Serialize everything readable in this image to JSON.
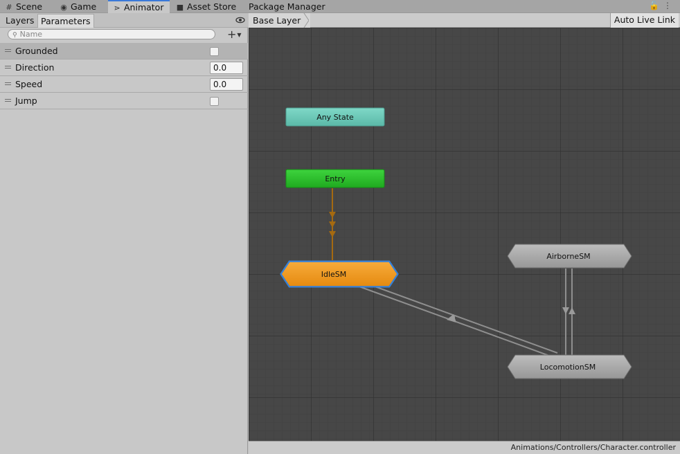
{
  "tabs": [
    {
      "label": "Scene",
      "icon": "grid-icon"
    },
    {
      "label": "Game",
      "icon": "gamepad-icon"
    },
    {
      "label": "Animator",
      "icon": "animator-icon",
      "active": true
    },
    {
      "label": "Asset Store",
      "icon": "bag-icon"
    },
    {
      "label": "Package Manager",
      "icon": "package-icon"
    }
  ],
  "left_panel": {
    "tabs": [
      "Layers",
      "Parameters"
    ],
    "search_placeholder": "Name",
    "parameters": [
      {
        "name": "Grounded",
        "type": "bool",
        "value": false,
        "selected": true
      },
      {
        "name": "Direction",
        "type": "float",
        "value": "0.0"
      },
      {
        "name": "Speed",
        "type": "float",
        "value": "0.0"
      },
      {
        "name": "Jump",
        "type": "trigger",
        "value": false
      }
    ]
  },
  "graph": {
    "breadcrumb": "Base Layer",
    "auto_live_link": "Auto Live Link",
    "nodes": {
      "any_state": "Any State",
      "entry": "Entry",
      "idle": "IdleSM",
      "airborne": "AirborneSM",
      "locomotion": "LocomotionSM"
    },
    "colors": {
      "any_state": "#6ccdbb",
      "entry": "#2dc12d",
      "idle": "#f39a1f",
      "state_machine": "#a9a9a9",
      "entry_transition": "#a56a10",
      "selection": "#3b8be6"
    },
    "status_path": "Animations/Controllers/Character.controller"
  }
}
